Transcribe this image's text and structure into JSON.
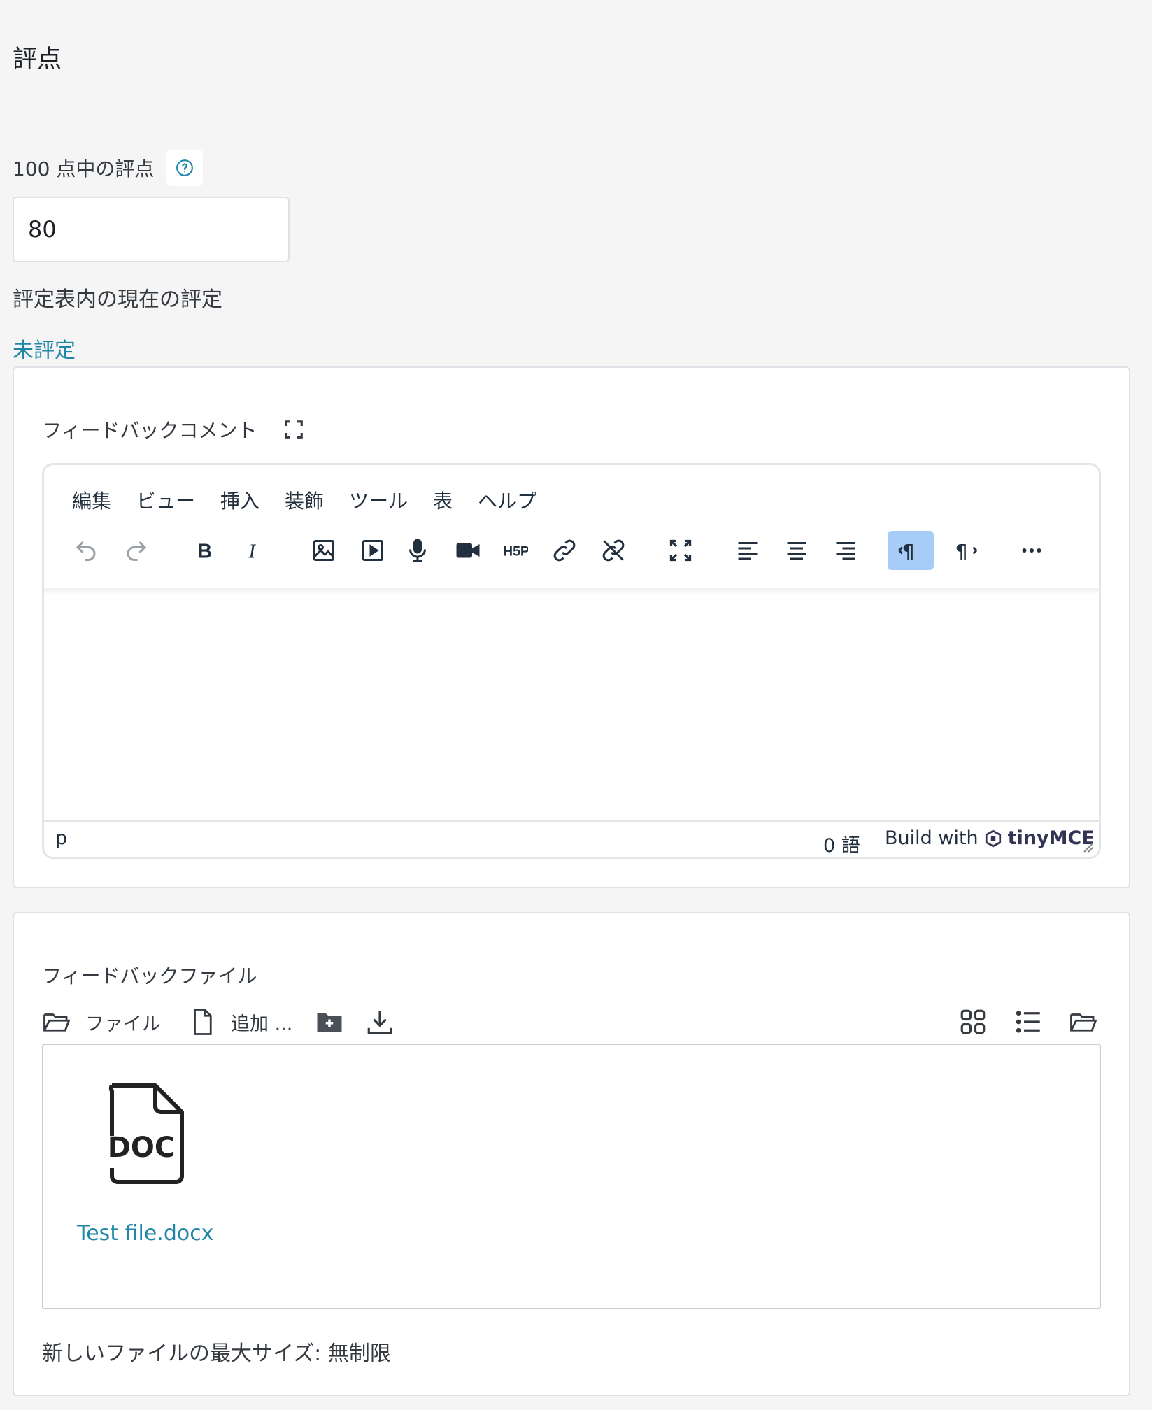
{
  "section": {
    "title": "評点"
  },
  "grade": {
    "label": "100 点中の評点",
    "value": "80"
  },
  "rubric": {
    "label": "評定表内の現在の評定",
    "status": "未評定"
  },
  "feedback_comments": {
    "label": "フィードバックコメント",
    "menu": [
      "編集",
      "ビュー",
      "挿入",
      "装飾",
      "ツール",
      "表",
      "ヘルプ"
    ],
    "toolbar_icons": [
      "undo-icon",
      "redo-icon",
      "bold-icon",
      "italic-icon",
      "image-icon",
      "media-icon",
      "microphone-icon",
      "video-camera-icon",
      "h5p-icon",
      "link-icon",
      "unlink-icon",
      "fullscreen-icon",
      "align-left-icon",
      "align-center-icon",
      "align-right-icon",
      "ltr-icon",
      "rtl-icon",
      "more-icon"
    ],
    "status_path": "p",
    "word_count": "0 語",
    "branding_prefix": "Build with",
    "branding_name": "tinyMCE"
  },
  "feedback_files": {
    "label": "フィードバックファイル",
    "toolbar": {
      "files_label": "ファイル",
      "add_label": "追加 ..."
    },
    "files": [
      {
        "name": "Test file.docx",
        "icon_text": "DOC"
      }
    ],
    "max_size": "新しいファイルの最大サイズ: 無制限"
  },
  "colors": {
    "link": "#1f86a8",
    "active_button": "#a6ccf7",
    "background": "#f5f5f5"
  }
}
